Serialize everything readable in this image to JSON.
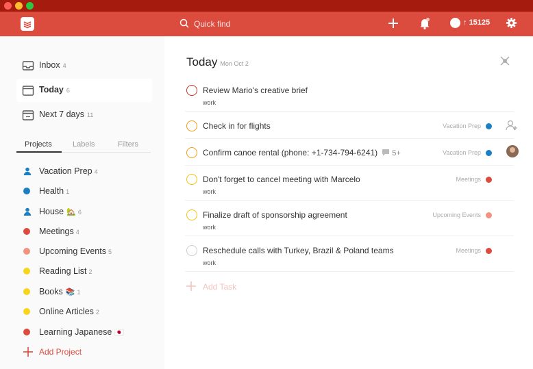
{
  "topbar": {
    "search_placeholder": "Quick find",
    "karma": "15125"
  },
  "sidebar": {
    "nav": [
      {
        "label": "Inbox",
        "count": "4",
        "icon": "inbox-icon"
      },
      {
        "label": "Today",
        "count": "6",
        "icon": "calendar-today-icon"
      },
      {
        "label": "Next 7 days",
        "count": "11",
        "icon": "calendar-week-icon"
      }
    ],
    "tabs": [
      "Projects",
      "Labels",
      "Filters"
    ],
    "projects": [
      {
        "label": "Vacation Prep",
        "count": "4",
        "color": "#1b7fc4",
        "icon": "person-icon",
        "emoji": ""
      },
      {
        "label": "Health",
        "count": "1",
        "color": "#1b7fc4",
        "icon": "dot",
        "emoji": ""
      },
      {
        "label": "House",
        "count": "6",
        "color": "#1b7fc4",
        "icon": "person-icon",
        "emoji": "🏡"
      },
      {
        "label": "Meetings",
        "count": "4",
        "color": "#db4c3f",
        "icon": "dot",
        "emoji": ""
      },
      {
        "label": "Upcoming Events",
        "count": "5",
        "color": "#f29382",
        "icon": "dot",
        "emoji": ""
      },
      {
        "label": "Reading List",
        "count": "2",
        "color": "#f7d51c",
        "icon": "dot",
        "emoji": ""
      },
      {
        "label": "Books",
        "count": "1",
        "color": "#f7d51c",
        "icon": "dot",
        "emoji": "📚"
      },
      {
        "label": "Online Articles",
        "count": "2",
        "color": "#f7d51c",
        "icon": "dot",
        "emoji": ""
      },
      {
        "label": "Learning Japanese",
        "count": "",
        "color": "#db4c3f",
        "icon": "dot",
        "emoji": "🇯🇵"
      }
    ],
    "add_project_label": "Add Project"
  },
  "main": {
    "title": "Today",
    "date": "Mon Oct 2",
    "tasks": [
      {
        "title": "Review Mario's creative brief",
        "sub": "work",
        "project": "",
        "project_color": "",
        "priority_color": "#c0392b",
        "comment": "",
        "extra": ""
      },
      {
        "title": "Check in for flights",
        "sub": "",
        "project": "Vacation Prep",
        "project_color": "#1b7fc4",
        "priority_color": "#f39c12",
        "comment": "",
        "extra": "assign-icon"
      },
      {
        "title": "Confirm canoe rental (phone: +1-734-794-6241)",
        "sub": "",
        "project": "Vacation Prep",
        "project_color": "#1b7fc4",
        "priority_color": "#f39c12",
        "comment": "5+",
        "extra": "avatar"
      },
      {
        "title": "Don't forget to cancel meeting with Marcelo",
        "sub": "work",
        "project": "Meetings",
        "project_color": "#db4c3f",
        "priority_color": "#f1c40f",
        "comment": "",
        "extra": ""
      },
      {
        "title": "Finalize draft of sponsorship agreement",
        "sub": "work",
        "project": "Upcoming Events",
        "project_color": "#f29382",
        "priority_color": "#f1c40f",
        "comment": "",
        "extra": ""
      },
      {
        "title": "Reschedule calls with Turkey, Brazil & Poland teams",
        "sub": "work",
        "project": "Meetings",
        "project_color": "#db4c3f",
        "priority_color": "#cccccc",
        "comment": "",
        "extra": ""
      }
    ],
    "add_task_label": "Add Task"
  },
  "colors": {
    "accent": "#db4c3f",
    "titlebar": "#a51c0e",
    "sidebar_bg": "#fafafa"
  }
}
